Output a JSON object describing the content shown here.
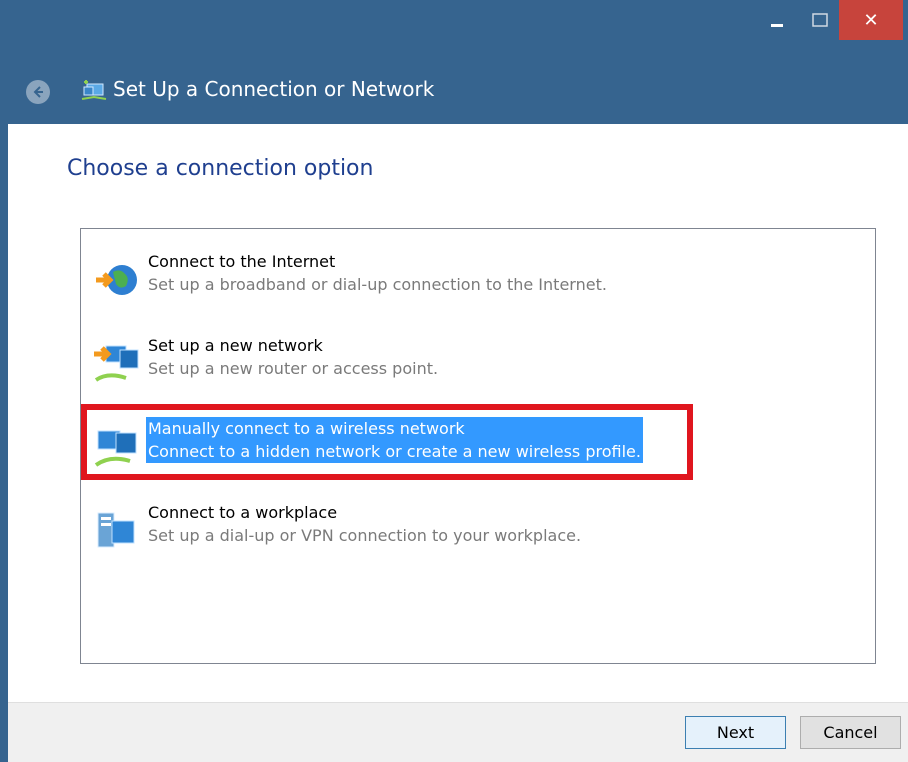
{
  "window": {
    "title": "Set Up a Connection or Network",
    "close_glyph": "✕"
  },
  "page": {
    "heading": "Choose a connection option"
  },
  "options": [
    {
      "title": "Connect to the Internet",
      "description": "Set up a broadband or dial-up connection to the Internet.",
      "icon": "globe-network-icon",
      "selected": false
    },
    {
      "title": "Set up a new network",
      "description": "Set up a new router or access point.",
      "icon": "new-network-icon",
      "selected": false
    },
    {
      "title": "Manually connect to a wireless network",
      "description": "Connect to a hidden network or create a new wireless profile.",
      "icon": "wireless-network-icon",
      "selected": true
    },
    {
      "title": "Connect to a workplace",
      "description": "Set up a dial-up or VPN connection to your workplace.",
      "icon": "workplace-server-icon",
      "selected": false
    }
  ],
  "buttons": {
    "next": "Next",
    "cancel": "Cancel"
  },
  "colors": {
    "titlebar": "#36648f",
    "heading": "#1f3f8f",
    "selection": "#3399ff",
    "highlight_border": "#e0161e",
    "close_button": "#c7443c"
  }
}
